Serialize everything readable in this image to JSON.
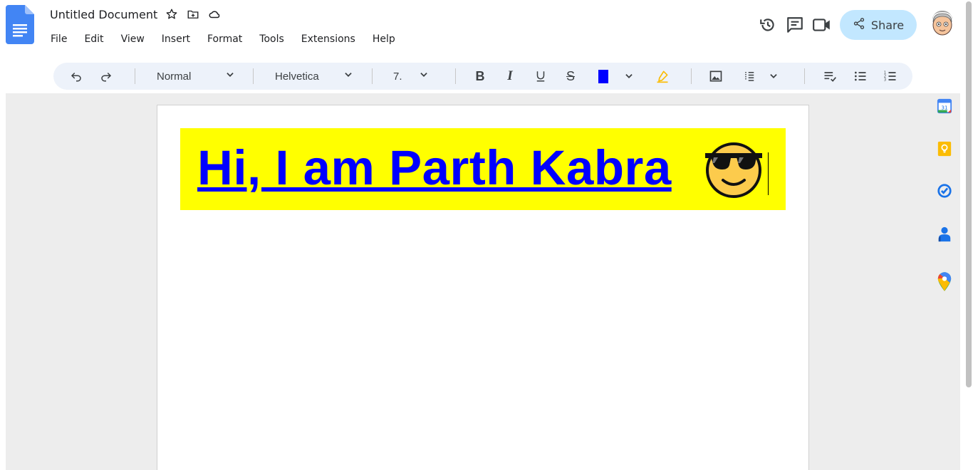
{
  "document": {
    "title": "Untitled Document"
  },
  "menu": [
    "File",
    "Edit",
    "View",
    "Insert",
    "Format",
    "Tools",
    "Extensions",
    "Help"
  ],
  "header": {
    "share_label": "Share"
  },
  "toolbar": {
    "style": "Normal",
    "font": "Helvetica",
    "font_size": "7.",
    "text_color": "#0000ff",
    "highlight_color": "#fbbc04"
  },
  "content": {
    "heading": "Hi, I am Parth Kabra ",
    "highlight": "#ffff00"
  },
  "side_panel": {
    "calendar_day": "31"
  },
  "colors": {
    "toolbar_bg": "#edf2fa",
    "share_bg": "#c2e7ff",
    "workspace_bg": "#ededed"
  }
}
